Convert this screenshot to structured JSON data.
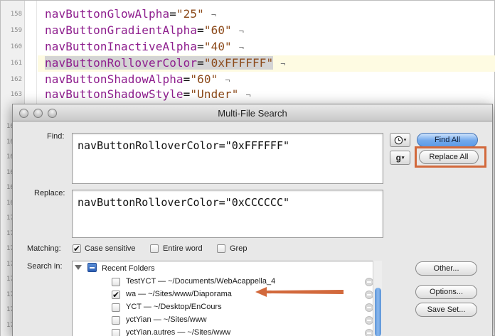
{
  "editor": {
    "lines": [
      {
        "num": "158",
        "attr": "navButtonGlowAlpha",
        "value": "\"25\"",
        "pilcrow": "¬"
      },
      {
        "num": "159",
        "attr": "navButtonGradientAlpha",
        "value": "\"60\"",
        "pilcrow": "¬"
      },
      {
        "num": "160",
        "attr": "navButtonInactiveAlpha",
        "value": "\"40\"",
        "pilcrow": "¬"
      },
      {
        "num": "161",
        "attr": "navButtonRolloverColor",
        "value": "\"0xFFFFFF\"",
        "pilcrow": "¬"
      },
      {
        "num": "162",
        "attr": "navButtonShadowAlpha",
        "value": "\"60\"",
        "pilcrow": "¬"
      },
      {
        "num": "163",
        "attr": "navButtonShadowStyle",
        "value": "\"Under\"",
        "pilcrow": "¬"
      }
    ],
    "partial_gutter": [
      "16",
      "16",
      "16",
      "16",
      "16",
      "16",
      "17",
      "17",
      "17",
      "17",
      "17",
      "17",
      "17",
      "17"
    ]
  },
  "dialog": {
    "title": "Multi-File Search",
    "find_label": "Find:",
    "find_value": "navButtonRolloverColor=\"0xFFFFFF\"",
    "replace_label": "Replace:",
    "replace_value": "navButtonRolloverColor=\"0xCCCCCC\"",
    "history_icon": "clock-icon",
    "grep_menu_label": "g",
    "find_all_label": "Find All",
    "replace_all_label": "Replace All",
    "matching_label": "Matching:",
    "case_sensitive_label": "Case sensitive",
    "case_sensitive_checked": true,
    "entire_word_label": "Entire word",
    "entire_word_checked": false,
    "grep_label": "Grep",
    "grep_checked": false,
    "search_in_label": "Search in:",
    "group_label": "Recent Folders",
    "folders": [
      {
        "label": "TestYCT — ~/Documents/WebAcappella_4",
        "checked": false
      },
      {
        "label": "wa — ~/Sites/www/Diaporama",
        "checked": true
      },
      {
        "label": "YCT — ~/Desktop/EnCours",
        "checked": false
      },
      {
        "label": "yctYian — ~/Sites/www",
        "checked": false
      },
      {
        "label": "yctYian.autres — ~/Sites/www",
        "checked": false
      }
    ],
    "other_label": "Other...",
    "options_label": "Options...",
    "save_set_label": "Save Set..."
  },
  "colors": {
    "highlight_box": "#d2693c",
    "arrow": "#d2693c",
    "default_button": "#5b9be8"
  }
}
